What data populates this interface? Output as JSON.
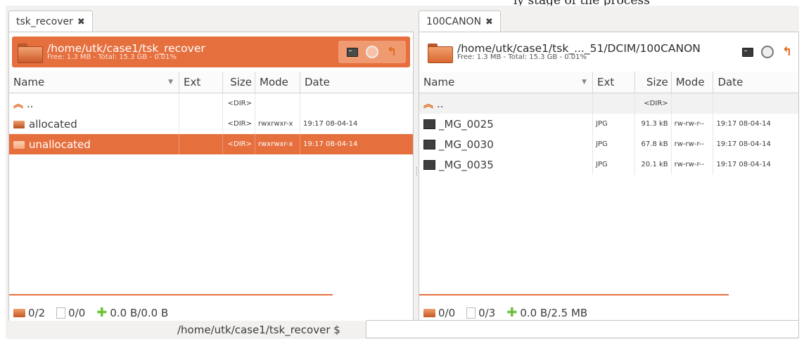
{
  "caption": "ly stage of the process",
  "left_pane": {
    "tab_title": "tsk_recover",
    "path": "/home/utk/case1/tsk_recover",
    "free": "Free: 1.3 MB - Total: 15.3 GB - 0.01%",
    "columns": [
      "Name",
      "Ext",
      "Size",
      "Mode",
      "Date"
    ],
    "rows": [
      {
        "name": "..",
        "ext": "",
        "size": "<DIR>",
        "mode": "",
        "date": "",
        "icon": "up-icon"
      },
      {
        "name": "allocated",
        "ext": "",
        "size": "<DIR>",
        "mode": "rwxrwxr-x",
        "date": "19:17 08-04-14",
        "icon": "folder-icon"
      },
      {
        "name": "unallocated",
        "ext": "",
        "size": "<DIR>",
        "mode": "rwxrwxr-x",
        "date": "19:17 08-04-14",
        "icon": "folder-icon",
        "selected": true
      }
    ],
    "status": {
      "dirs": "0/2",
      "files": "0/0",
      "bytes": "0.0 B/0.0 B"
    }
  },
  "right_pane": {
    "tab_title": "100CANON",
    "path": "/home/utk/case1/tsk_..._51/DCIM/100CANON",
    "free": "Free: 1.3 MB - Total: 15.3 GB - 0.01%",
    "columns": [
      "Name",
      "Ext",
      "Size",
      "Mode",
      "Date"
    ],
    "rows": [
      {
        "name": "..",
        "ext": "",
        "size": "<DIR>",
        "mode": "",
        "date": "",
        "icon": "up-icon"
      },
      {
        "name": "_MG_0025",
        "ext": "JPG",
        "size": "91.3 kB",
        "mode": "rw-rw-r--",
        "date": "19:17 08-04-14",
        "icon": "image-icon"
      },
      {
        "name": "_MG_0030",
        "ext": "JPG",
        "size": "67.8 kB",
        "mode": "rw-rw-r--",
        "date": "19:17 08-04-14",
        "icon": "image-icon"
      },
      {
        "name": "_MG_0035",
        "ext": "JPG",
        "size": "20.1 kB",
        "mode": "rw-rw-r--",
        "date": "19:17 08-04-14",
        "icon": "image-icon"
      }
    ],
    "status": {
      "dirs": "0/0",
      "files": "0/3",
      "bytes": "0.0 B/2.5 MB"
    }
  },
  "command_line": {
    "prompt": "/home/utk/case1/tsk_recover $",
    "value": ""
  },
  "colors": {
    "accent": "#e66f3e",
    "panel_bg": "#f2f1f0"
  }
}
